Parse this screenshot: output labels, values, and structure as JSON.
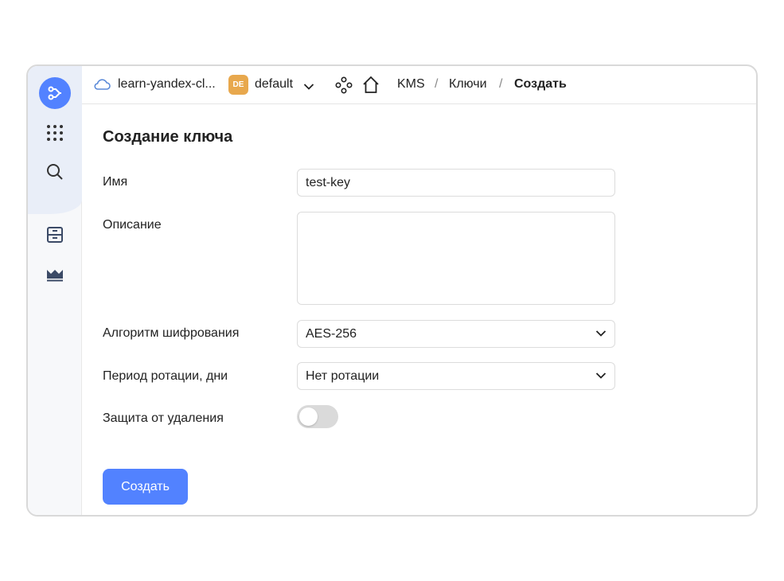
{
  "topbar": {
    "cloud_name": "learn-yandex-cl...",
    "folder_badge": "DE",
    "folder_name": "default",
    "breadcrumbs": [
      "KMS",
      "Ключи",
      "Создать"
    ],
    "separator": "/"
  },
  "sidebar": {
    "items": [
      "logo-icon",
      "apps-grid-icon",
      "search-icon",
      "archive-icon",
      "chart-icon"
    ]
  },
  "form": {
    "title": "Создание ключа",
    "name_label": "Имя",
    "name_value": "test-key",
    "description_label": "Описание",
    "description_value": "",
    "algorithm_label": "Алгоритм шифрования",
    "algorithm_value": "AES-256",
    "rotation_label": "Период ротации, дни",
    "rotation_value": "Нет ротации",
    "deletion_protection_label": "Защита от удаления",
    "deletion_protection_on": false,
    "submit_label": "Создать"
  },
  "colors": {
    "accent": "#5282ff",
    "folder_badge": "#e8a84d",
    "sidebar_highlight": "#e9eef8"
  }
}
